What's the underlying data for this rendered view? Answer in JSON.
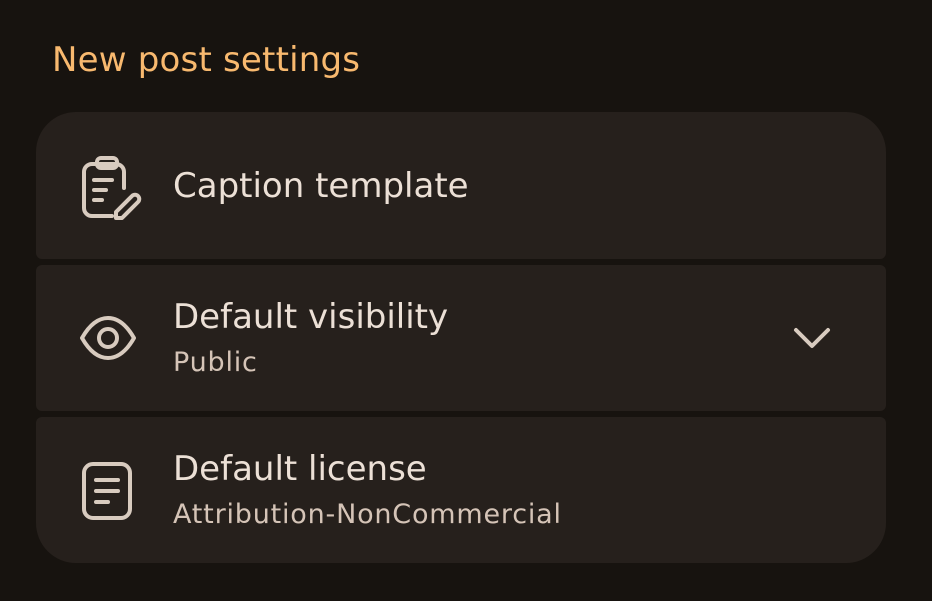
{
  "section": {
    "title": "New post settings"
  },
  "items": [
    {
      "label": "Caption template",
      "icon": "clipboard-edit-icon"
    },
    {
      "label": "Default visibility",
      "value": "Public",
      "icon": "eye-icon",
      "trailing_icon": "chevron-down-icon"
    },
    {
      "label": "Default license",
      "value": "Attribution-NonCommercial",
      "icon": "document-icon"
    }
  ],
  "colors": {
    "background": "#17130f",
    "card": "#26201c",
    "accent": "#f8b96f",
    "text_primary": "#ece0d6",
    "text_secondary": "#d5c4b7"
  }
}
